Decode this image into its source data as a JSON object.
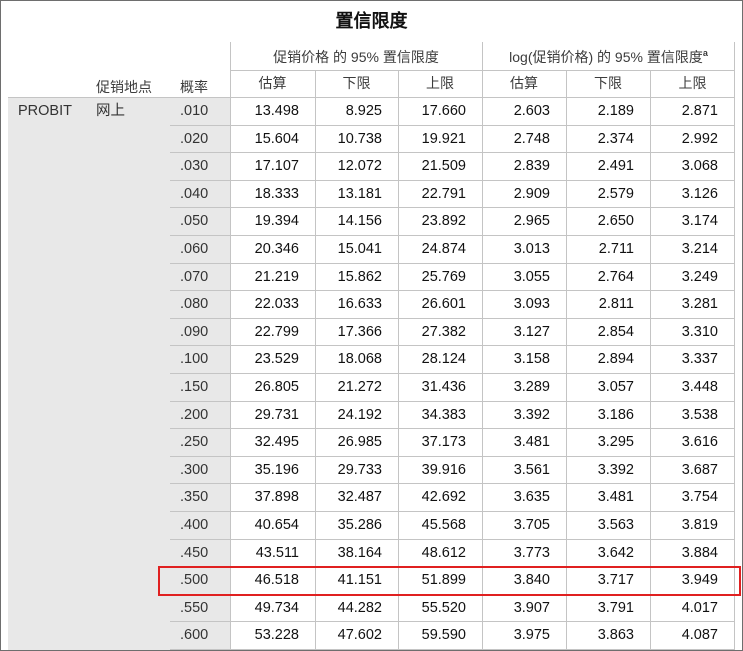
{
  "title": "置信限度",
  "columns": {
    "location": "促销地点",
    "probability": "概率",
    "price_group": "促销价格 的 95% 置信限度",
    "log_group": "log(促销价格) 的 95% 置信限度",
    "log_group_note": "a",
    "price_subcols": [
      "估算",
      "下限",
      "上限"
    ],
    "log_subcols": [
      "估算",
      "下限",
      "上限"
    ]
  },
  "row_labels": {
    "method": "PROBIT",
    "location": "网上"
  },
  "rows": [
    {
      "prob": ".010",
      "est": "13.498",
      "lower": "8.925",
      "upper": "17.660",
      "log_est": "2.603",
      "log_lower": "2.189",
      "log_upper": "2.871"
    },
    {
      "prob": ".020",
      "est": "15.604",
      "lower": "10.738",
      "upper": "19.921",
      "log_est": "2.748",
      "log_lower": "2.374",
      "log_upper": "2.992"
    },
    {
      "prob": ".030",
      "est": "17.107",
      "lower": "12.072",
      "upper": "21.509",
      "log_est": "2.839",
      "log_lower": "2.491",
      "log_upper": "3.068"
    },
    {
      "prob": ".040",
      "est": "18.333",
      "lower": "13.181",
      "upper": "22.791",
      "log_est": "2.909",
      "log_lower": "2.579",
      "log_upper": "3.126"
    },
    {
      "prob": ".050",
      "est": "19.394",
      "lower": "14.156",
      "upper": "23.892",
      "log_est": "2.965",
      "log_lower": "2.650",
      "log_upper": "3.174"
    },
    {
      "prob": ".060",
      "est": "20.346",
      "lower": "15.041",
      "upper": "24.874",
      "log_est": "3.013",
      "log_lower": "2.711",
      "log_upper": "3.214"
    },
    {
      "prob": ".070",
      "est": "21.219",
      "lower": "15.862",
      "upper": "25.769",
      "log_est": "3.055",
      "log_lower": "2.764",
      "log_upper": "3.249"
    },
    {
      "prob": ".080",
      "est": "22.033",
      "lower": "16.633",
      "upper": "26.601",
      "log_est": "3.093",
      "log_lower": "2.811",
      "log_upper": "3.281"
    },
    {
      "prob": ".090",
      "est": "22.799",
      "lower": "17.366",
      "upper": "27.382",
      "log_est": "3.127",
      "log_lower": "2.854",
      "log_upper": "3.310"
    },
    {
      "prob": ".100",
      "est": "23.529",
      "lower": "18.068",
      "upper": "28.124",
      "log_est": "3.158",
      "log_lower": "2.894",
      "log_upper": "3.337"
    },
    {
      "prob": ".150",
      "est": "26.805",
      "lower": "21.272",
      "upper": "31.436",
      "log_est": "3.289",
      "log_lower": "3.057",
      "log_upper": "3.448"
    },
    {
      "prob": ".200",
      "est": "29.731",
      "lower": "24.192",
      "upper": "34.383",
      "log_est": "3.392",
      "log_lower": "3.186",
      "log_upper": "3.538"
    },
    {
      "prob": ".250",
      "est": "32.495",
      "lower": "26.985",
      "upper": "37.173",
      "log_est": "3.481",
      "log_lower": "3.295",
      "log_upper": "3.616"
    },
    {
      "prob": ".300",
      "est": "35.196",
      "lower": "29.733",
      "upper": "39.916",
      "log_est": "3.561",
      "log_lower": "3.392",
      "log_upper": "3.687"
    },
    {
      "prob": ".350",
      "est": "37.898",
      "lower": "32.487",
      "upper": "42.692",
      "log_est": "3.635",
      "log_lower": "3.481",
      "log_upper": "3.754"
    },
    {
      "prob": ".400",
      "est": "40.654",
      "lower": "35.286",
      "upper": "45.568",
      "log_est": "3.705",
      "log_lower": "3.563",
      "log_upper": "3.819"
    },
    {
      "prob": ".450",
      "est": "43.511",
      "lower": "38.164",
      "upper": "48.612",
      "log_est": "3.773",
      "log_lower": "3.642",
      "log_upper": "3.884"
    },
    {
      "prob": ".500",
      "est": "46.518",
      "lower": "41.151",
      "upper": "51.899",
      "log_est": "3.840",
      "log_lower": "3.717",
      "log_upper": "3.949",
      "highlighted": true
    },
    {
      "prob": ".550",
      "est": "49.734",
      "lower": "44.282",
      "upper": "55.520",
      "log_est": "3.907",
      "log_lower": "3.791",
      "log_upper": "4.017"
    },
    {
      "prob": ".600",
      "est": "53.228",
      "lower": "47.602",
      "upper": "59.590",
      "log_est": "3.975",
      "log_lower": "3.863",
      "log_upper": "4.087"
    }
  ],
  "colors": {
    "highlight": "#e02020",
    "row_label_background": "#e8e8e8",
    "grid": "#c4c4c4"
  }
}
